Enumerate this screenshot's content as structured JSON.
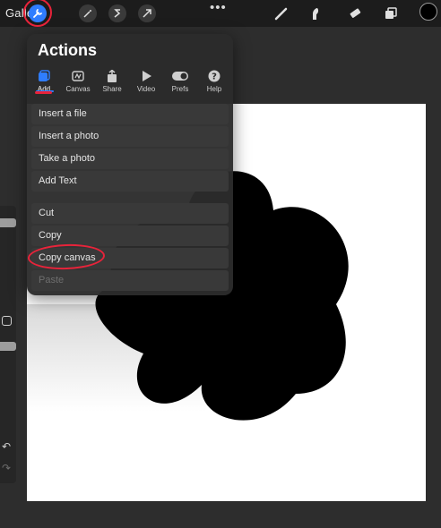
{
  "topbar": {
    "gallery_label": "Gallery",
    "more_label": "•••",
    "icons": [
      "wrench-icon",
      "wand-icon",
      "selection-icon",
      "transform-arrow-icon",
      "brush-icon",
      "smudge-icon",
      "eraser-icon",
      "layers-icon"
    ],
    "color": "#000000"
  },
  "panel": {
    "title": "Actions",
    "tabs": [
      {
        "label": "Add",
        "icon": "add-icon",
        "active": true
      },
      {
        "label": "Canvas",
        "icon": "canvas-icon",
        "active": false
      },
      {
        "label": "Share",
        "icon": "share-icon",
        "active": false
      },
      {
        "label": "Video",
        "icon": "video-play-icon",
        "active": false
      },
      {
        "label": "Prefs",
        "icon": "toggle-icon",
        "active": false
      },
      {
        "label": "Help",
        "icon": "help-icon",
        "active": false
      }
    ],
    "items": [
      {
        "label": "Insert a file",
        "enabled": true
      },
      {
        "label": "Insert a photo",
        "enabled": true
      },
      {
        "label": "Take a photo",
        "enabled": true
      },
      {
        "label": "Add Text",
        "enabled": true
      },
      {
        "label": "Cut",
        "enabled": true
      },
      {
        "label": "Copy",
        "enabled": true
      },
      {
        "label": "Copy canvas",
        "enabled": true
      },
      {
        "label": "Paste",
        "enabled": false
      }
    ]
  },
  "colors": {
    "accent": "#2f7dff",
    "annotation": "#e8233a",
    "canvas": "#ffffff",
    "shape": "#000000"
  }
}
